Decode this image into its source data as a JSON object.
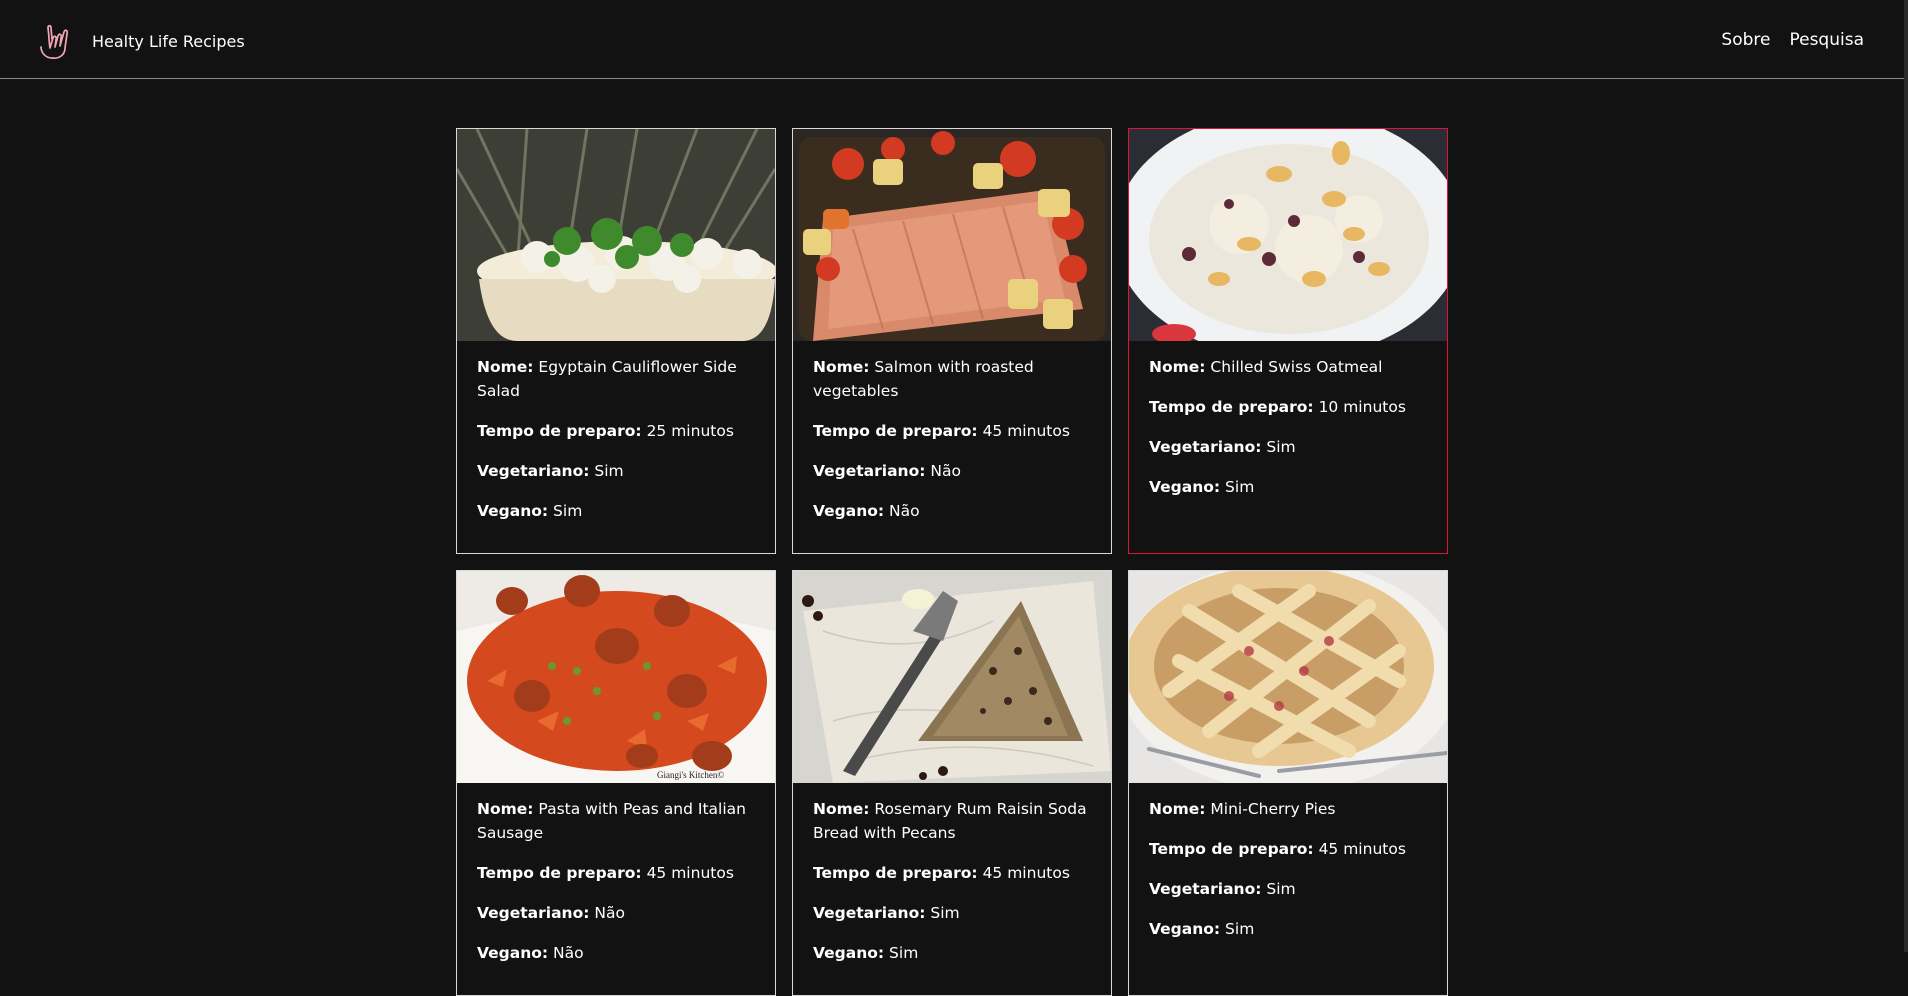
{
  "header": {
    "brand_name": "Healty Life Recipes",
    "nav": [
      "Sobre",
      "Pesquisa"
    ]
  },
  "labels": {
    "name": "Nome:",
    "prep_time": "Tempo de preparo:",
    "vegetarian": "Vegetariano:",
    "vegan": "Vegano:"
  },
  "recipes": [
    {
      "name": "Egyptain Cauliflower Side Salad",
      "prep_time": "25 minutos",
      "vegetarian": "Sim",
      "vegan": "Sim",
      "image": "cauliflower-salad-photo"
    },
    {
      "name": "Salmon with roasted vegetables",
      "prep_time": "45 minutos",
      "vegetarian": "Não",
      "vegan": "Não",
      "image": "salmon-photo"
    },
    {
      "name": "Chilled Swiss Oatmeal",
      "prep_time": "10 minutos",
      "vegetarian": "Sim",
      "vegan": "Sim",
      "image": "oatmeal-photo"
    },
    {
      "name": "Pasta with Peas and Italian Sausage",
      "prep_time": "45 minutos",
      "vegetarian": "Não",
      "vegan": "Não",
      "image": "pasta-photo",
      "image_caption": "Giangi's Kitchen©"
    },
    {
      "name": "Rosemary Rum Raisin Soda Bread with Pecans",
      "prep_time": "45 minutos",
      "vegetarian": "Sim",
      "vegan": "Sim",
      "image": "soda-bread-photo"
    },
    {
      "name": "Mini-Cherry Pies",
      "prep_time": "45 minutos",
      "vegetarian": "Sim",
      "vegan": "Sim",
      "image": "cherry-pie-photo"
    }
  ],
  "colors": {
    "background": "#121212",
    "text": "#ffffff",
    "card_border": "#d9d9d9",
    "hover_border": "#dc143c",
    "logo": "#f2a7b5"
  },
  "hovered_card": 2
}
